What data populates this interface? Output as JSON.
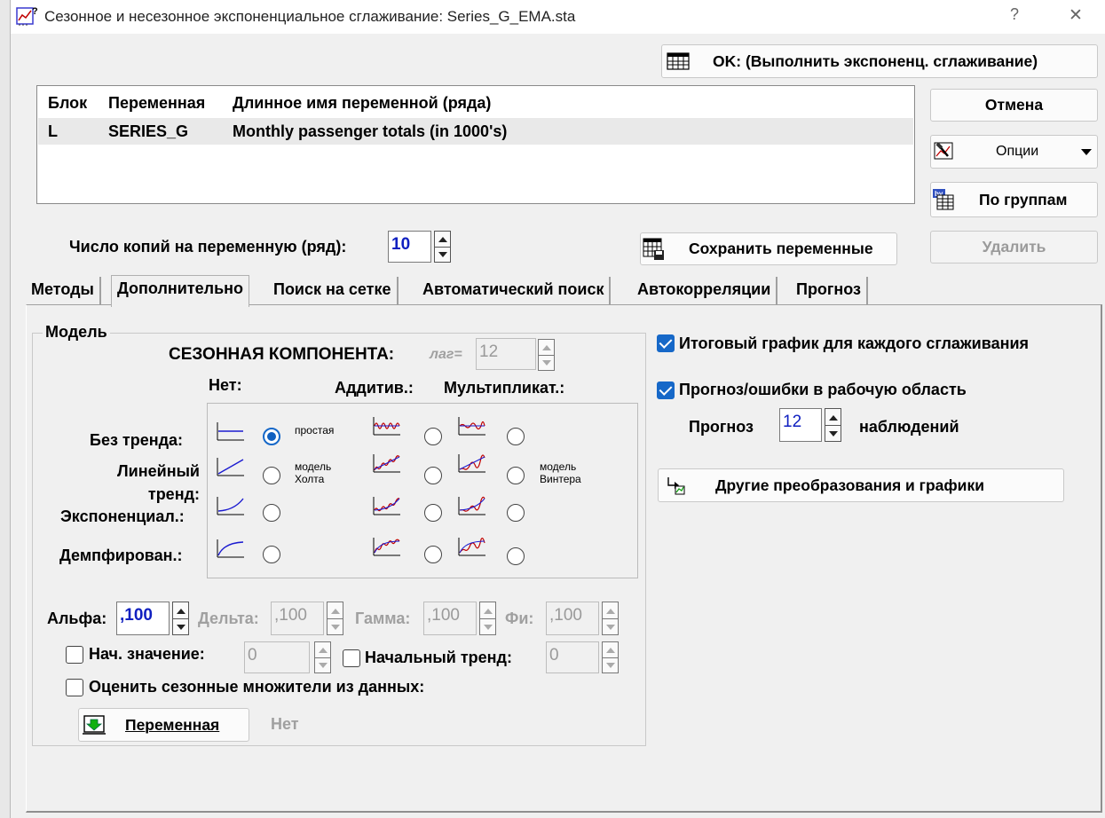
{
  "window": {
    "title": "Сезонное и несезонное экспоненциальное сглаживание: Series_G_EMA.sta",
    "help": "?",
    "close": "✕"
  },
  "buttons": {
    "ok": "OK: (Выполнить экспоненц. сглаживание)",
    "cancel": "Отмена",
    "options": "Опции",
    "by_groups": "По группам",
    "save_vars": "Сохранить переменные",
    "delete": "Удалить",
    "other_transforms": "Другие преобразования и графики",
    "variable": "Переменная"
  },
  "grid": {
    "headers": [
      "Блок",
      "Переменная",
      "Длинное имя переменной (ряда)"
    ],
    "rows": [
      [
        "L",
        "SERIES_G",
        "Monthly passenger totals (in 1000's)"
      ]
    ]
  },
  "copies": {
    "label": "Число копий на переменную (ряд):",
    "value": "10"
  },
  "tabs": [
    "Методы",
    "Дополнительно",
    "Поиск на сетке",
    "Автоматический поиск",
    "Автокорреляции",
    "Прогноз"
  ],
  "active_tab": "Дополнительно",
  "model": {
    "group_title": "Модель",
    "seasonal_label": "СЕЗОННАЯ КОМПОНЕНТА:",
    "lag_label": "лаг=",
    "lag_value": "12",
    "col_none": "Нет:",
    "col_additive": "Аддитив.:",
    "col_multiplicative": "Мультипликат.:",
    "rows": [
      "Без тренда:",
      "Линейный тренд:",
      "Экспоненциал.:",
      "Демпфирован.:"
    ],
    "note_simple": "простая",
    "note_holt_1": "модель",
    "note_holt_2": "Холта",
    "note_winters_1": "модель",
    "note_winters_2": "Винтера",
    "selected": "Без тренда / Нет"
  },
  "params": {
    "alpha_label": "Альфа:",
    "alpha": ",100",
    "delta_label": "Дельта:",
    "delta": ",100",
    "gamma_label": "Гамма:",
    "gamma": ",100",
    "phi_label": "Фи:",
    "phi": ",100",
    "init_value_label": "Нач. значение:",
    "init_value": "0",
    "init_trend_label": "Начальный тренд:",
    "init_trend": "0",
    "estimate_seasonal_label": "Оценить сезонные множители из данных:",
    "none_label": "Нет"
  },
  "right": {
    "summary_chart": "Итоговый график для каждого сглаживания",
    "forecast_errors": "Прогноз/ошибки в рабочую область",
    "forecast_label": "Прогноз",
    "forecast_value": "12",
    "observations_label": "наблюдений"
  },
  "colors": {
    "accent": "#1668c8",
    "icon_red": "#c00000",
    "icon_blue": "#1a1ad0"
  }
}
